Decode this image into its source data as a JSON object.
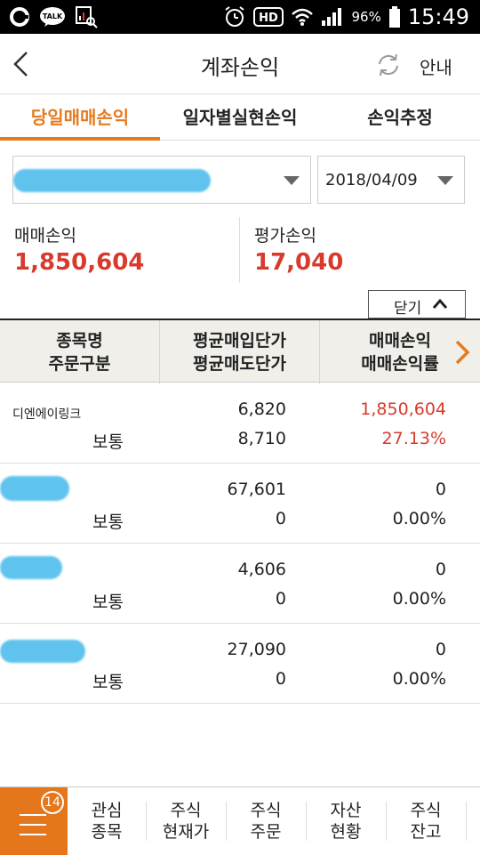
{
  "status_bar": {
    "battery": "96%",
    "time": "15:49",
    "hd_label": "HD",
    "talk_label": "TALK"
  },
  "header": {
    "title": "계좌손익",
    "guide_label": "안내"
  },
  "tabs": [
    {
      "label": "당일매매손익",
      "active": true
    },
    {
      "label": "일자별실현손익",
      "active": false
    },
    {
      "label": "손익추정",
      "active": false
    }
  ],
  "filters": {
    "date": "2018/04/09"
  },
  "summary": {
    "trade_pl_label": "매매손익",
    "trade_pl_value": "1,850,604",
    "eval_pl_label": "평가손익",
    "eval_pl_value": "17,040"
  },
  "close_button": {
    "label": "닫기"
  },
  "table": {
    "headers": [
      {
        "line1": "종목명",
        "line2": "주문구분"
      },
      {
        "line1": "평균매입단가",
        "line2": "평균매도단가"
      },
      {
        "line1": "매매손익",
        "line2": "매매손익률"
      }
    ],
    "rows": [
      {
        "name": "디엔에이링크",
        "order_type": "보통",
        "avg_buy": "6,820",
        "avg_sell": "8,710",
        "pl": "1,850,604",
        "pl_rate": "27.13%"
      },
      {
        "name": "",
        "order_type": "보통",
        "avg_buy": "67,601",
        "avg_sell": "0",
        "pl": "0",
        "pl_rate": "0.00%"
      },
      {
        "name": "",
        "order_type": "보통",
        "avg_buy": "4,606",
        "avg_sell": "0",
        "pl": "0",
        "pl_rate": "0.00%"
      },
      {
        "name": "",
        "order_type": "보통",
        "avg_buy": "27,090",
        "avg_sell": "0",
        "pl": "0",
        "pl_rate": "0.00%"
      }
    ]
  },
  "bottom_nav": {
    "badge": "14",
    "items": [
      {
        "line1": "관심",
        "line2": "종목"
      },
      {
        "line1": "주식",
        "line2": "현재가"
      },
      {
        "line1": "주식",
        "line2": "주문"
      },
      {
        "line1": "자산",
        "line2": "현황"
      },
      {
        "line1": "주식",
        "line2": "잔고"
      }
    ]
  },
  "colors": {
    "accent_orange": "#e47b1f",
    "profit_red": "#d83a2c",
    "header_bg": "#f0efea",
    "redaction_blue": "#5fc3ee"
  }
}
